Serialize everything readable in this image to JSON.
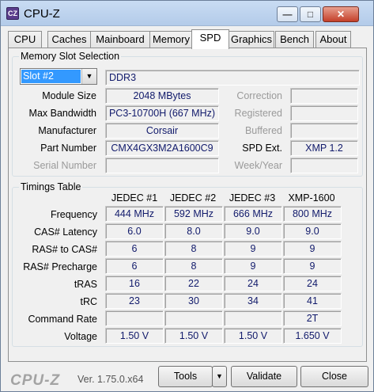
{
  "window": {
    "title": "CPU-Z",
    "icon_text": "CZ"
  },
  "tabs": [
    {
      "label": "CPU"
    },
    {
      "label": "Caches"
    },
    {
      "label": "Mainboard"
    },
    {
      "label": "Memory"
    },
    {
      "label": "SPD",
      "active": true
    },
    {
      "label": "Graphics"
    },
    {
      "label": "Bench"
    },
    {
      "label": "About"
    }
  ],
  "slot": {
    "group_title": "Memory Slot Selection",
    "selected": "Slot #2",
    "type": "DDR3",
    "labels": {
      "module_size": "Module Size",
      "max_bandwidth": "Max Bandwidth",
      "manufacturer": "Manufacturer",
      "part_number": "Part Number",
      "serial_number": "Serial Number",
      "correction": "Correction",
      "registered": "Registered",
      "buffered": "Buffered",
      "spd_ext": "SPD Ext.",
      "week_year": "Week/Year"
    },
    "values": {
      "module_size": "2048 MBytes",
      "max_bandwidth": "PC3-10700H (667 MHz)",
      "manufacturer": "Corsair",
      "part_number": "CMX4GX3M2A1600C9",
      "serial_number": "",
      "correction": "",
      "registered": "",
      "buffered": "",
      "spd_ext": "XMP 1.2",
      "week_year": ""
    }
  },
  "timings": {
    "group_title": "Timings Table",
    "columns": [
      "JEDEC #1",
      "JEDEC #2",
      "JEDEC #3",
      "XMP-1600"
    ],
    "rows": [
      {
        "label": "Frequency",
        "values": [
          "444 MHz",
          "592 MHz",
          "666 MHz",
          "800 MHz"
        ]
      },
      {
        "label": "CAS# Latency",
        "values": [
          "6.0",
          "8.0",
          "9.0",
          "9.0"
        ]
      },
      {
        "label": "RAS# to CAS#",
        "values": [
          "6",
          "8",
          "9",
          "9"
        ]
      },
      {
        "label": "RAS# Precharge",
        "values": [
          "6",
          "8",
          "9",
          "9"
        ]
      },
      {
        "label": "tRAS",
        "values": [
          "16",
          "22",
          "24",
          "24"
        ]
      },
      {
        "label": "tRC",
        "values": [
          "23",
          "30",
          "34",
          "41"
        ]
      },
      {
        "label": "Command Rate",
        "values": [
          "",
          "",
          "",
          "2T"
        ]
      },
      {
        "label": "Voltage",
        "values": [
          "1.50 V",
          "1.50 V",
          "1.50 V",
          "1.650 V"
        ]
      }
    ]
  },
  "footer": {
    "brand": "CPU-Z",
    "version": "Ver. 1.75.0.x64",
    "tools_label": "Tools",
    "validate_label": "Validate",
    "close_label": "Close"
  }
}
